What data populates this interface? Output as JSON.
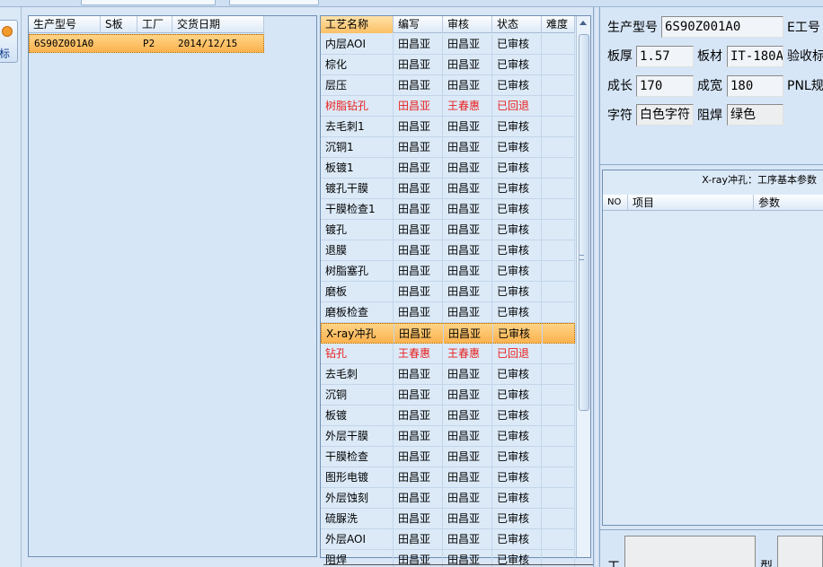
{
  "left_button": {
    "label": "标"
  },
  "order_grid": {
    "columns": [
      "生产型号",
      "S板",
      "工厂",
      "交货日期"
    ],
    "rows": [
      {
        "model": "6S90Z001A0",
        "s_board": "",
        "factory": "P2",
        "delivery_date": "2014/12/15"
      }
    ]
  },
  "process_grid": {
    "columns": [
      "工艺名称",
      "编写",
      "审核",
      "状态",
      "难度"
    ],
    "rows": [
      {
        "name": "内层AOI",
        "writer": "田昌亚",
        "reviewer": "田昌亚",
        "status": "已审核",
        "difficulty": ""
      },
      {
        "name": "棕化",
        "writer": "田昌亚",
        "reviewer": "田昌亚",
        "status": "已审核",
        "difficulty": ""
      },
      {
        "name": "层压",
        "writer": "田昌亚",
        "reviewer": "田昌亚",
        "status": "已审核",
        "difficulty": ""
      },
      {
        "name": "树脂钻孔",
        "writer": "田昌亚",
        "reviewer": "王春惠",
        "status": "已回退",
        "difficulty": ""
      },
      {
        "name": "去毛刺1",
        "writer": "田昌亚",
        "reviewer": "田昌亚",
        "status": "已审核",
        "difficulty": ""
      },
      {
        "name": "沉铜1",
        "writer": "田昌亚",
        "reviewer": "田昌亚",
        "status": "已审核",
        "difficulty": ""
      },
      {
        "name": "板镀1",
        "writer": "田昌亚",
        "reviewer": "田昌亚",
        "status": "已审核",
        "difficulty": ""
      },
      {
        "name": "镀孔干膜",
        "writer": "田昌亚",
        "reviewer": "田昌亚",
        "status": "已审核",
        "difficulty": ""
      },
      {
        "name": "干膜检查1",
        "writer": "田昌亚",
        "reviewer": "田昌亚",
        "status": "已审核",
        "difficulty": ""
      },
      {
        "name": "镀孔",
        "writer": "田昌亚",
        "reviewer": "田昌亚",
        "status": "已审核",
        "difficulty": ""
      },
      {
        "name": "退膜",
        "writer": "田昌亚",
        "reviewer": "田昌亚",
        "status": "已审核",
        "difficulty": ""
      },
      {
        "name": "树脂塞孔",
        "writer": "田昌亚",
        "reviewer": "田昌亚",
        "status": "已审核",
        "difficulty": ""
      },
      {
        "name": "磨板",
        "writer": "田昌亚",
        "reviewer": "田昌亚",
        "status": "已审核",
        "difficulty": ""
      },
      {
        "name": "磨板检查",
        "writer": "田昌亚",
        "reviewer": "田昌亚",
        "status": "已审核",
        "difficulty": ""
      },
      {
        "name": "X-ray冲孔",
        "writer": "田昌亚",
        "reviewer": "田昌亚",
        "status": "已审核",
        "difficulty": ""
      },
      {
        "name": "钻孔",
        "writer": "王春惠",
        "reviewer": "王春惠",
        "status": "已回退",
        "difficulty": ""
      },
      {
        "name": "去毛刺",
        "writer": "田昌亚",
        "reviewer": "田昌亚",
        "status": "已审核",
        "difficulty": ""
      },
      {
        "name": "沉铜",
        "writer": "田昌亚",
        "reviewer": "田昌亚",
        "status": "已审核",
        "difficulty": ""
      },
      {
        "name": "板镀",
        "writer": "田昌亚",
        "reviewer": "田昌亚",
        "status": "已审核",
        "difficulty": ""
      },
      {
        "name": "外层干膜",
        "writer": "田昌亚",
        "reviewer": "田昌亚",
        "status": "已审核",
        "difficulty": ""
      },
      {
        "name": "干膜检查",
        "writer": "田昌亚",
        "reviewer": "田昌亚",
        "status": "已审核",
        "difficulty": ""
      },
      {
        "name": "图形电镀",
        "writer": "田昌亚",
        "reviewer": "田昌亚",
        "status": "已审核",
        "difficulty": ""
      },
      {
        "name": "外层蚀刻",
        "writer": "田昌亚",
        "reviewer": "田昌亚",
        "status": "已审核",
        "difficulty": ""
      },
      {
        "name": "硫脲洗",
        "writer": "田昌亚",
        "reviewer": "田昌亚",
        "status": "已审核",
        "difficulty": ""
      },
      {
        "name": "外层AOI",
        "writer": "田昌亚",
        "reviewer": "田昌亚",
        "status": "已审核",
        "difficulty": ""
      },
      {
        "name": "阻焊",
        "writer": "田昌亚",
        "reviewer": "田昌亚",
        "status": "已审核",
        "difficulty": ""
      }
    ],
    "selected_index": 14,
    "red_rows": [
      3,
      15
    ],
    "colors": {
      "selected": "#fbb24e",
      "rollback_text": "#e8201e"
    }
  },
  "info": {
    "model_label": "生产型号",
    "model_value": "6S90Z001A0",
    "e_label": "E工号",
    "thickness_label": "板厚",
    "thickness_value": "1.57",
    "material_label": "板材",
    "material_value": "IT-180A",
    "acceptance_label": "验收标",
    "length_label": "成长",
    "length_value": "170",
    "width_label": "成宽",
    "width_value": "180",
    "pnl_label": "PNL规",
    "char_label": "字符",
    "char_value": "白色字符",
    "mask_label": "阻焊",
    "mask_value": "绿色"
  },
  "params": {
    "title": "X-ray冲孔：工序基本参数",
    "columns": [
      "NO",
      "项目",
      "参数"
    ]
  },
  "bottom": {
    "label_left": "工",
    "label_mid": "型"
  }
}
